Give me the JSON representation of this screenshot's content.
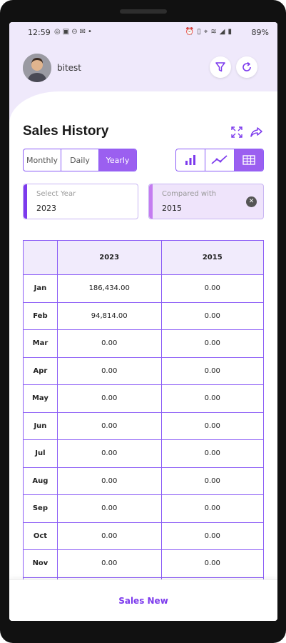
{
  "status_bar": {
    "time": "12:59",
    "left_icons": [
      "whatsapp-icon",
      "instagram-icon",
      "app-icon",
      "mail-icon",
      "dot-icon"
    ],
    "right_icons": [
      "alarm-icon",
      "vibrate-icon",
      "hotspot-icon",
      "wifi-icon",
      "signal-icon",
      "battery-icon"
    ],
    "battery": "89%"
  },
  "header": {
    "username": "bitest",
    "filter_icon": "filter-icon",
    "refresh_icon": "refresh-icon"
  },
  "page": {
    "title": "Sales History",
    "expand_icon": "expand-icon",
    "share_icon": "share-icon"
  },
  "period_tabs": [
    {
      "label": "Monthly",
      "active": false
    },
    {
      "label": "Daily",
      "active": false
    },
    {
      "label": "Yearly",
      "active": true
    }
  ],
  "view_modes": [
    {
      "icon": "bar-chart-icon",
      "active": false
    },
    {
      "icon": "line-chart-icon",
      "active": false
    },
    {
      "icon": "table-icon",
      "active": true
    }
  ],
  "select_year": {
    "label": "Select Year",
    "value": "2023"
  },
  "compare_year": {
    "label": "Compared with",
    "value": "2015"
  },
  "table": {
    "headers": [
      "",
      "2023",
      "2015"
    ],
    "rows": [
      [
        "Jan",
        "186,434.00",
        "0.00"
      ],
      [
        "Feb",
        "94,814.00",
        "0.00"
      ],
      [
        "Mar",
        "0.00",
        "0.00"
      ],
      [
        "Apr",
        "0.00",
        "0.00"
      ],
      [
        "May",
        "0.00",
        "0.00"
      ],
      [
        "Jun",
        "0.00",
        "0.00"
      ],
      [
        "Jul",
        "0.00",
        "0.00"
      ],
      [
        "Aug",
        "0.00",
        "0.00"
      ],
      [
        "Sep",
        "0.00",
        "0.00"
      ],
      [
        "Oct",
        "0.00",
        "0.00"
      ],
      [
        "Nov",
        "0.00",
        "0.00"
      ],
      [
        "",
        "",
        ""
      ]
    ]
  },
  "bottom": {
    "button_label": "Sales New"
  },
  "colors": {
    "accent": "#9b5ff0",
    "accent_dark": "#7c3aed",
    "header_bg": "#efe9fb"
  }
}
